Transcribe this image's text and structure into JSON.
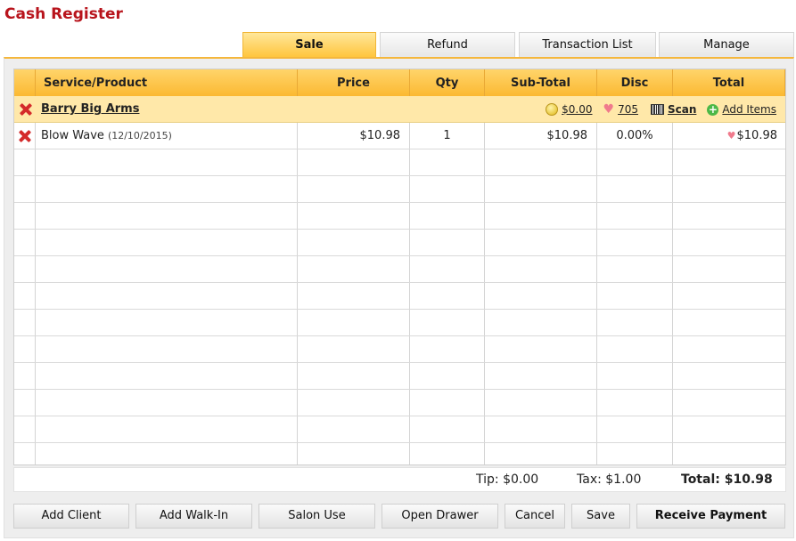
{
  "app": {
    "title": "Cash Register"
  },
  "tabs": [
    {
      "label": "Sale",
      "active": true
    },
    {
      "label": "Refund",
      "active": false
    },
    {
      "label": "Transaction List",
      "active": false
    },
    {
      "label": "Manage",
      "active": false
    }
  ],
  "table": {
    "headers": [
      "Service/Product",
      "Price",
      "Qty",
      "Sub-Total",
      "Disc",
      "Total"
    ],
    "client": {
      "name": "Barry Big Arms",
      "balance": "$0.00",
      "points": "705",
      "scan_label": "Scan",
      "add_items_label": "Add Items"
    },
    "items": [
      {
        "name": "Blow Wave",
        "date": "(12/10/2015)",
        "price": "$10.98",
        "qty": "1",
        "subtotal": "$10.98",
        "disc": "0.00%",
        "total": "$10.98"
      }
    ],
    "empty_rows": 12
  },
  "summary": {
    "tip": "Tip: $0.00",
    "tax": "Tax: $1.00",
    "total": "Total: $10.98"
  },
  "buttons": {
    "add_client": "Add Client",
    "add_walk_in": "Add Walk-In",
    "salon_use": "Salon Use",
    "open_drawer": "Open Drawer",
    "cancel": "Cancel",
    "save": "Save",
    "receive_payment": "Receive Payment"
  },
  "colors": {
    "title": "#b8141c",
    "accent": "#fbb932",
    "client_row": "#ffe8a9",
    "delete": "#d42a2a"
  }
}
